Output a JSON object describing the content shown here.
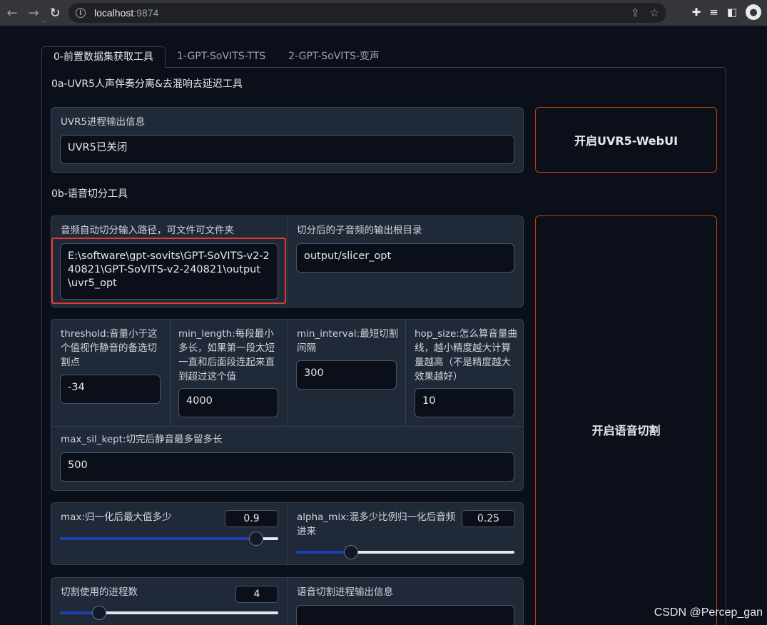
{
  "browser": {
    "url_host": "localhost",
    "url_port": ":9874"
  },
  "tabs": [
    {
      "label": "0-前置数据集获取工具"
    },
    {
      "label": "1-GPT-SoVITS-TTS"
    },
    {
      "label": "2-GPT-SoVITS-变声"
    }
  ],
  "uvr5": {
    "section_title": "0a-UVR5人声伴奏分离&去混响去延迟工具",
    "output_label": "UVR5进程输出信息",
    "output_value": "UVR5已关闭",
    "open_button": "开启UVR5-WebUI"
  },
  "slicer": {
    "section_title": "0b-语音切分工具",
    "input_path_label": "音频自动切分输入路径，可文件可文件夹",
    "input_path_value": "E:\\software\\gpt-sovits\\GPT-SoVITS-v2-240821\\GPT-SoVITS-v2-240821\\output\\uvr5_opt",
    "output_dir_label": "切分后的子音频的输出根目录",
    "output_dir_value": "output/slicer_opt",
    "threshold_label": "threshold:音量小于这个值视作静音的备选切割点",
    "threshold_value": "-34",
    "min_length_label": "min_length:每段最小多长，如果第一段太短一直和后面段连起来直到超过这个值",
    "min_length_value": "4000",
    "min_interval_label": "min_interval:最短切割间隔",
    "min_interval_value": "300",
    "hop_size_label": "hop_size:怎么算音量曲线，越小精度越大计算量越高（不是精度越大效果越好）",
    "hop_size_value": "10",
    "max_sil_kept_label": "max_sil_kept:切完后静音最多留多长",
    "max_sil_kept_value": "500",
    "max_label": "max:归一化后最大值多少",
    "max_value": "0.9",
    "max_fraction": 0.9,
    "alpha_mix_label": "alpha_mix:混多少比例归一化后音频进来",
    "alpha_mix_value": "0.25",
    "alpha_mix_fraction": 0.25,
    "n_process_label": "切割使用的进程数",
    "n_process_value": "4",
    "n_process_fraction": 0.18,
    "slicer_output_label": "语音切割进程输出信息",
    "open_button": "开启语音切割"
  },
  "watermark": "CSDN @Percep_gan"
}
